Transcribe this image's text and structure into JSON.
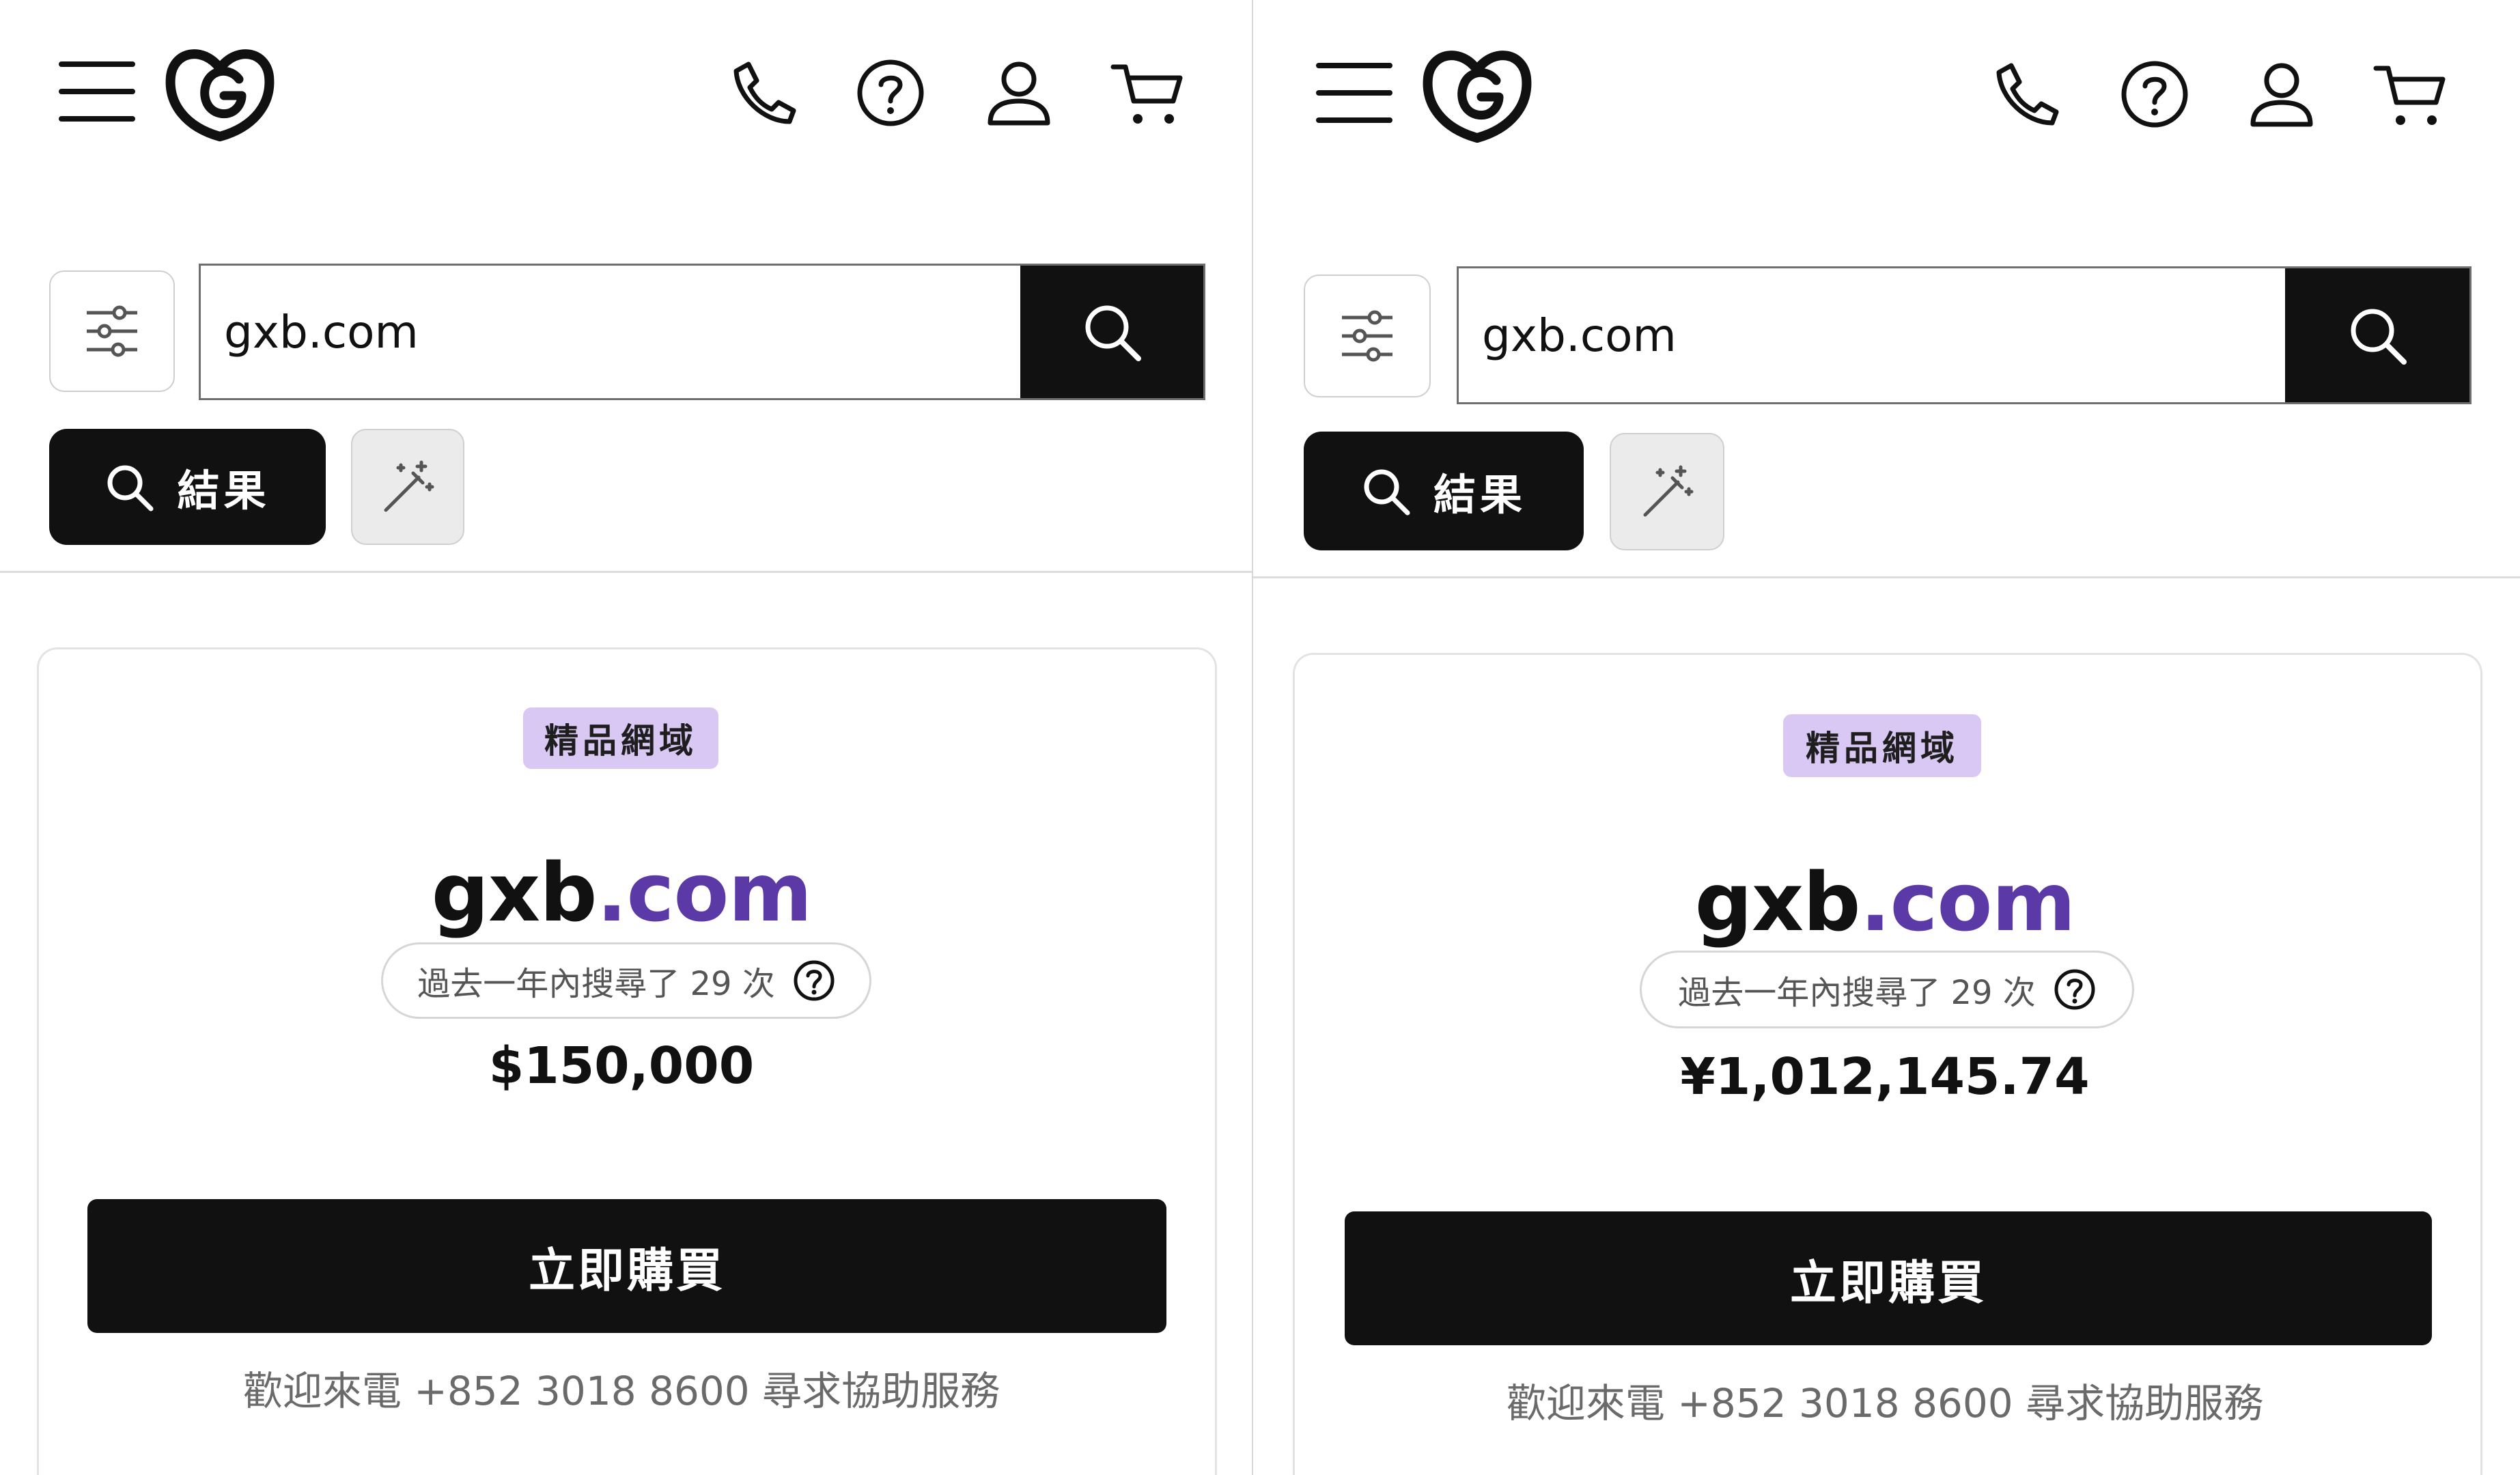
{
  "panels": [
    {
      "search": {
        "value": "gxb.com"
      },
      "tabs": {
        "results_label": "結果"
      },
      "result": {
        "badge": "精品網域",
        "sld": "gxb",
        "tld": ".com",
        "search_count_text": "過去一年內搜尋了 29 次",
        "price": "$150,000",
        "buy_label": "立即購買",
        "help_text": "歡迎來電 +852 3018 8600 尋求協助服務"
      }
    },
    {
      "search": {
        "value": "gxb.com"
      },
      "tabs": {
        "results_label": "結果"
      },
      "result": {
        "badge": "精品網域",
        "sld": "gxb",
        "tld": ".com",
        "search_count_text": "過去一年內搜尋了 29 次",
        "price": "¥1,012,145.74",
        "buy_label": "立即購買",
        "help_text": "歡迎來電 +852 3018 8600 尋求協助服務"
      }
    }
  ],
  "icons": {
    "menu": "hamburger-menu-icon",
    "logo": "godaddy-logo",
    "phone": "phone-icon",
    "help": "help-circle-icon",
    "account": "user-icon",
    "cart": "cart-icon",
    "filter": "sliders-icon",
    "search": "search-icon",
    "ai": "magic-wand-icon"
  },
  "colors": {
    "primary": "#111111",
    "tld_accent": "#5b3aa8",
    "badge_bg": "#d9c7f4",
    "help_text": "#6a6a6a"
  }
}
